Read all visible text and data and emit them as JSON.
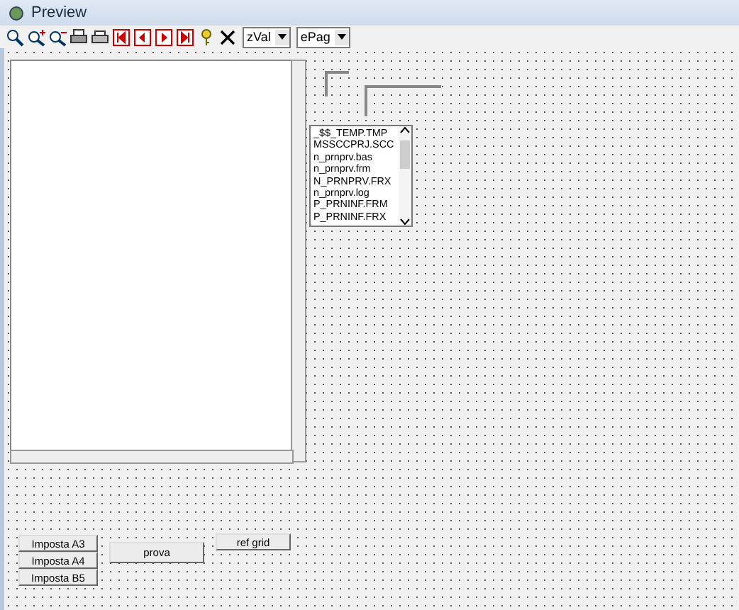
{
  "window": {
    "title": "Preview"
  },
  "toolbar": {
    "combos": [
      "zVal",
      "ePag"
    ]
  },
  "file_list": {
    "items": [
      "_$$_TEMP.TMP",
      "MSSCCPRJ.SCC",
      "n_prnprv.bas",
      "n_prnprv.frm",
      "N_PRNPRV.FRX",
      "n_prnprv.log",
      "P_PRNINF.FRM",
      "P_PRNINF.FRX"
    ]
  },
  "buttons": [
    "Imposta A3",
    "Imposta A4",
    "Imposta B5",
    "prova",
    "ref grid"
  ]
}
